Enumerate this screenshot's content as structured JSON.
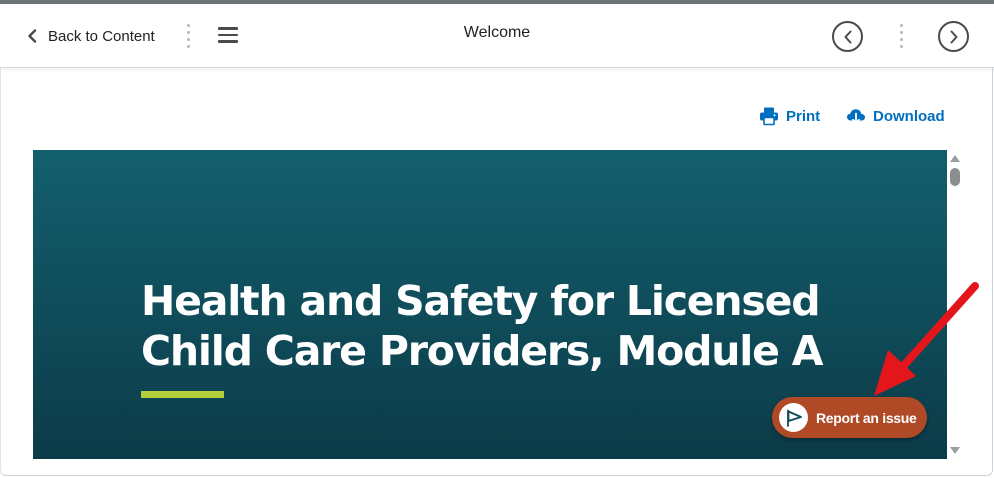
{
  "navbar": {
    "back_label": "Back to Content",
    "title": "Welcome"
  },
  "toolbar": {
    "print_label": "Print",
    "download_label": "Download"
  },
  "banner": {
    "heading": "Health and Safety for Licensed Child Care Providers, Module A"
  },
  "report": {
    "label": "Report an issue"
  },
  "icons": {
    "back": "chevron-left-icon",
    "menu": "hamburger-icon",
    "prev": "chevron-left-circle-icon",
    "next": "chevron-right-circle-icon",
    "print": "printer-icon",
    "download": "cloud-download-icon",
    "report": "flag-icon"
  },
  "colors": {
    "link": "#006fbf",
    "banner": "#0f4b59",
    "accent": "#b5cc3b",
    "report_button": "#b04a26",
    "annotation_arrow": "#e3161b"
  }
}
